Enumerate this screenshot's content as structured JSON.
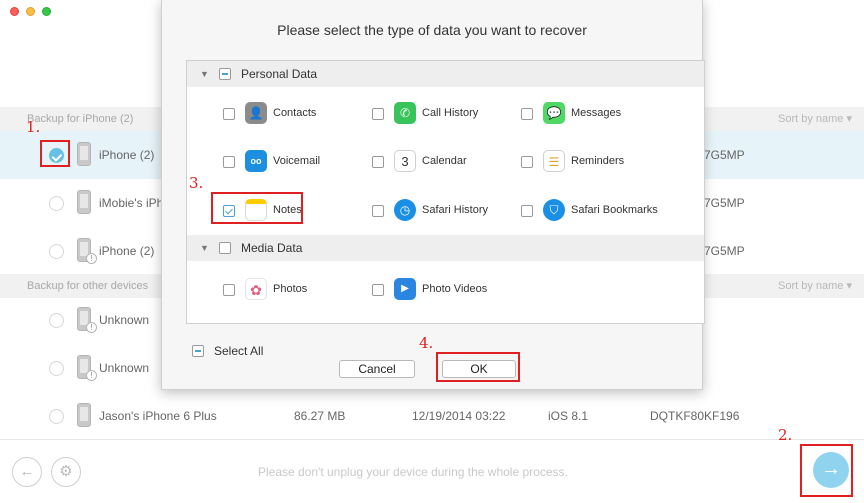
{
  "background": {
    "section1": {
      "title": "Backup for iPhone (2)",
      "sort": "Sort by name ▾"
    },
    "section2": {
      "title": "Backup for other devices",
      "sort": "Sort by name ▾"
    },
    "rows1": [
      {
        "name": "iPhone (2)",
        "serial": "7G5MP"
      },
      {
        "name": "iMobie's iPh",
        "serial": "7G5MP"
      },
      {
        "name": "iPhone (2)",
        "serial": "7G5MP"
      }
    ],
    "rows2": [
      {
        "name": "Unknown"
      },
      {
        "name": "Unknown"
      },
      {
        "name": "Jason's iPhone 6 Plus",
        "size": "86.27 MB",
        "date": "12/19/2014 03:22",
        "os": "iOS 8.1",
        "serial": "DQTKF80KF196"
      }
    ]
  },
  "footer": {
    "message": "Please don't unplug your device during the whole process.",
    "back_glyph": "←",
    "settings_glyph": "⚙",
    "next_glyph": "→"
  },
  "dialog": {
    "title": "Please select the type of data you want to recover",
    "groups": [
      {
        "label": "Personal Data",
        "items": [
          {
            "label": "Contacts",
            "glyph": "👤"
          },
          {
            "label": "Call History",
            "glyph": "✆"
          },
          {
            "label": "Messages",
            "glyph": "💬"
          },
          {
            "label": "Voicemail",
            "glyph": "oo"
          },
          {
            "label": "Calendar",
            "glyph": "3"
          },
          {
            "label": "Reminders",
            "glyph": "☰"
          },
          {
            "label": "Notes",
            "glyph": ""
          },
          {
            "label": "Safari History",
            "glyph": "◷"
          },
          {
            "label": "Safari Bookmarks",
            "glyph": "⛉"
          }
        ]
      },
      {
        "label": "Media Data",
        "items": [
          {
            "label": "Photos",
            "glyph": "✿"
          },
          {
            "label": "Photo Videos",
            "glyph": "▶"
          }
        ]
      }
    ],
    "select_all": "Select All",
    "cancel": "Cancel",
    "ok": "OK"
  },
  "annotations": [
    "1.",
    "2.",
    "3.",
    "4."
  ]
}
